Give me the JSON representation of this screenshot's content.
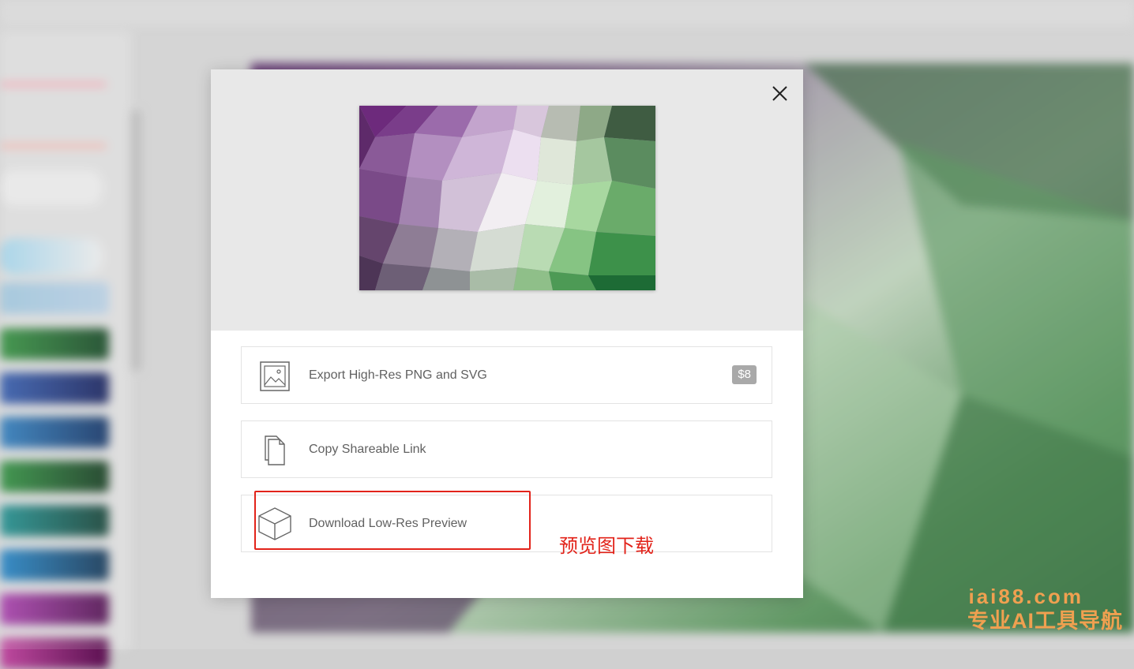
{
  "modal": {
    "close_icon": "close-icon",
    "options": [
      {
        "label": "Export High-Res PNG and SVG",
        "icon": "image-icon",
        "badge": "$8"
      },
      {
        "label": "Copy Shareable Link",
        "icon": "document-copy-icon"
      },
      {
        "label": "Download Low-Res Preview",
        "icon": "cube-icon"
      }
    ]
  },
  "annotation": {
    "label": "预览图下载",
    "color": "#e2231a"
  },
  "watermark": {
    "line1": "iai88.com",
    "line2": "专业AI工具导航"
  },
  "colors": {
    "preview_purple": "#6b2a7a",
    "preview_green": "#1d6b35",
    "badge_gray": "#a9a9a9"
  }
}
